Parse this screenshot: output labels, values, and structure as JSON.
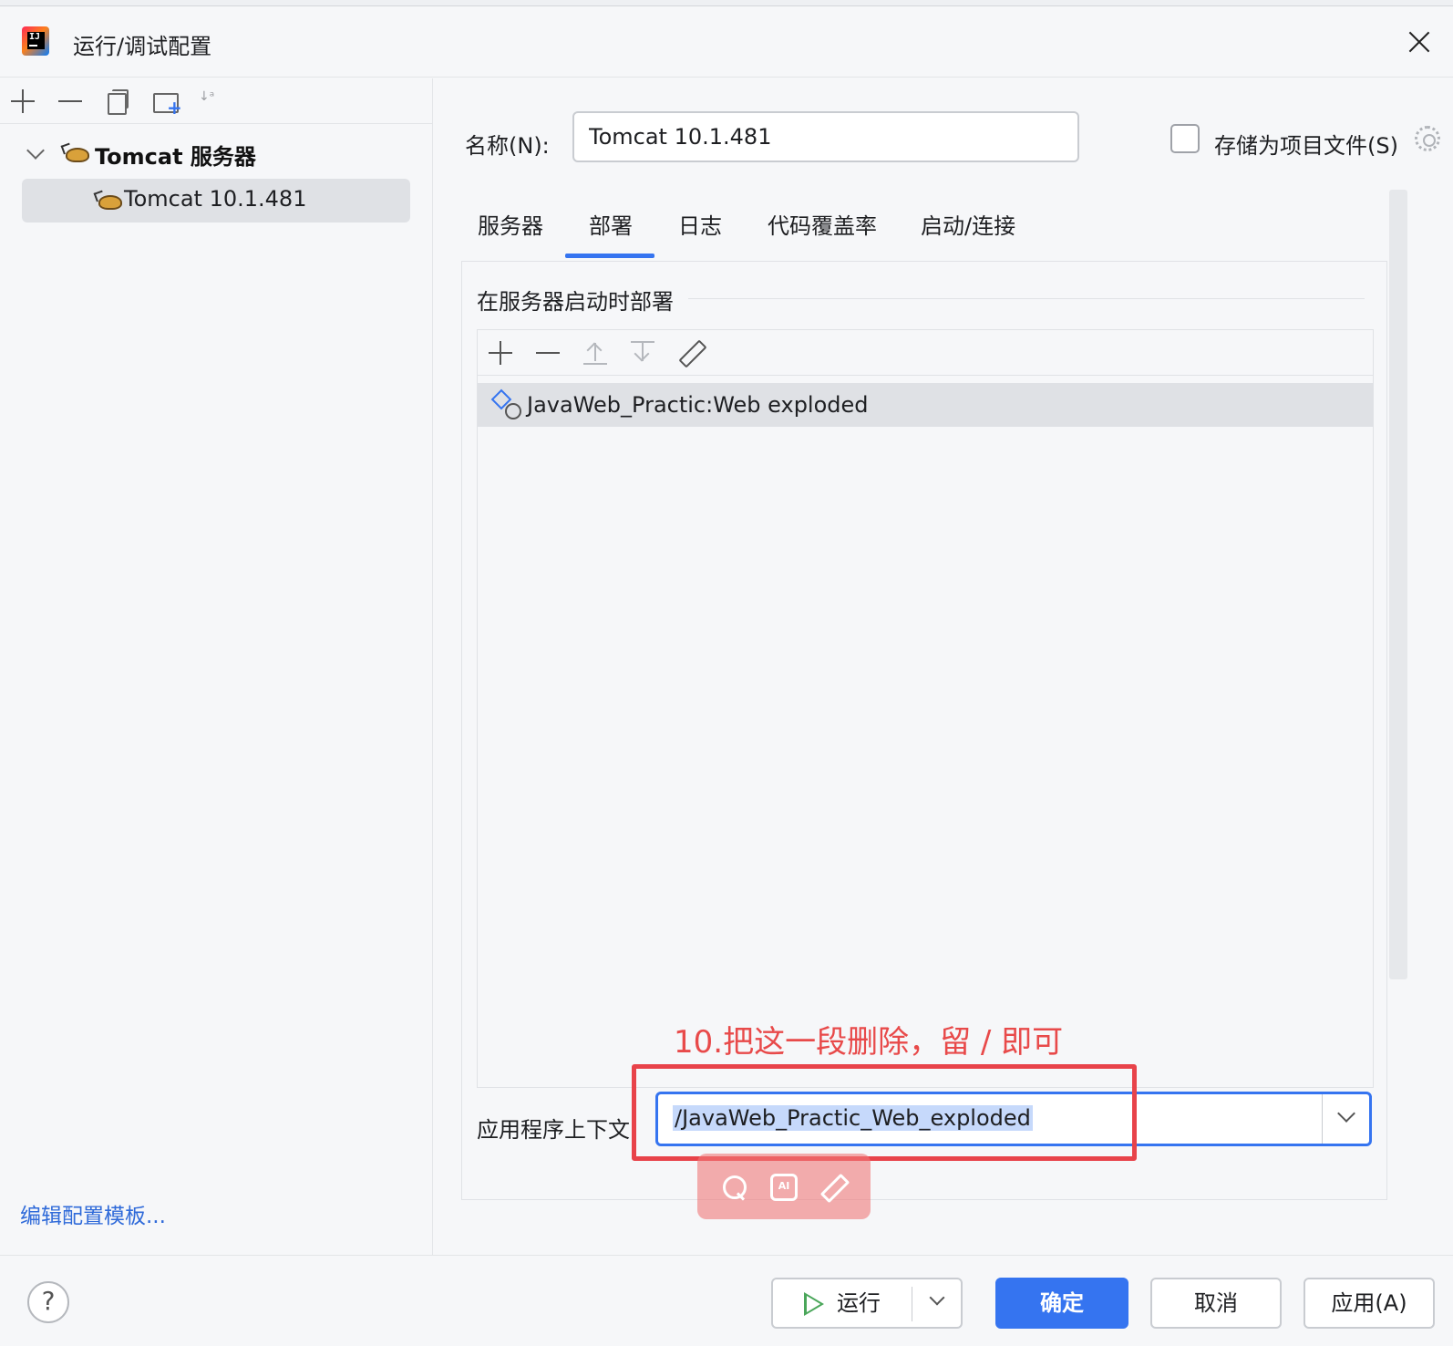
{
  "window": {
    "title": "运行/调试配置",
    "close_icon": "close-icon"
  },
  "left_panel": {
    "toolbar_icons": [
      "plus-icon",
      "minus-icon",
      "copy-icon",
      "new-folder-icon",
      "sort-icon"
    ],
    "sort_glyph": "↓ᵃ",
    "tree": {
      "group_label": "Tomcat 服务器",
      "item_label": "Tomcat 10.1.481"
    },
    "edit_templates_link": "编辑配置模板..."
  },
  "form": {
    "name_label": "名称(N):",
    "name_value": "Tomcat 10.1.481",
    "store_checkbox_label": "存储为项目文件(S)",
    "store_checked": false
  },
  "tabs": [
    {
      "label": "服务器"
    },
    {
      "label": "部署"
    },
    {
      "label": "日志"
    },
    {
      "label": "代码覆盖率"
    },
    {
      "label": "启动/连接"
    }
  ],
  "active_tab": "部署",
  "deploy": {
    "section_title": "在服务器启动时部署",
    "artifacts": [
      {
        "label": "JavaWeb_Practic:Web exploded"
      }
    ],
    "context_label": "应用程序上下文:",
    "context_value": "/JavaWeb_Practic_Web_exploded"
  },
  "annotation": "10.把这一段删除，留  /  即可",
  "floating_toolbar": {
    "ai_label": "AI"
  },
  "footer": {
    "help_label": "?",
    "run_label": "运行",
    "ok_label": "确定",
    "cancel_label": "取消",
    "apply_label": "应用(A)"
  },
  "colors": {
    "accent": "#3574f0",
    "annotation_red": "#e84a4a",
    "selection": "#dfe1e5"
  }
}
